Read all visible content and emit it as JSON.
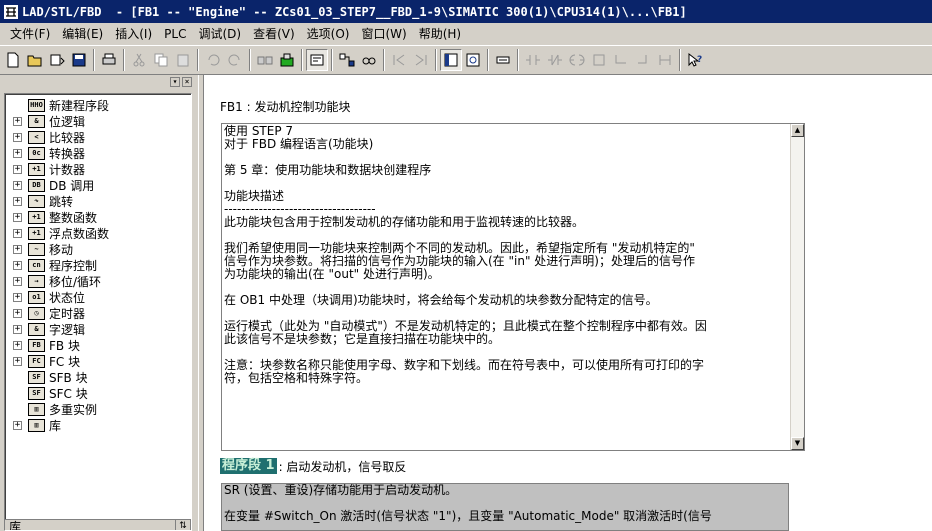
{
  "window": {
    "title": "LAD/STL/FBD  - [FB1 -- \"Engine\" -- ZCs01_03_STEP7__FBD_1-9\\SIMATIC 300(1)\\CPU314(1)\\...\\FB1]"
  },
  "menu": [
    "文件(F)",
    "编辑(E)",
    "插入(I)",
    "PLC",
    "调试(D)",
    "查看(V)",
    "选项(O)",
    "窗口(W)",
    "帮助(H)"
  ],
  "tree": {
    "items": [
      {
        "label": "新建程序段",
        "icon": "HHO",
        "expandable": false
      },
      {
        "label": "位逻辑",
        "icon": "&",
        "expandable": true
      },
      {
        "label": "比较器",
        "icon": "<",
        "expandable": true
      },
      {
        "label": "转换器",
        "icon": "0c",
        "expandable": true
      },
      {
        "label": "计数器",
        "icon": "+1",
        "expandable": true
      },
      {
        "label": "DB 调用",
        "icon": "DB",
        "expandable": true
      },
      {
        "label": "跳转",
        "icon": "↷",
        "expandable": true
      },
      {
        "label": "整数函数",
        "icon": "+1",
        "expandable": true
      },
      {
        "label": "浮点数函数",
        "icon": "+1",
        "expandable": true
      },
      {
        "label": "移动",
        "icon": "~",
        "expandable": true
      },
      {
        "label": "程序控制",
        "icon": "cn",
        "expandable": true
      },
      {
        "label": "移位/循环",
        "icon": "→",
        "expandable": true
      },
      {
        "label": "状态位",
        "icon": "o1",
        "expandable": true
      },
      {
        "label": "定时器",
        "icon": "◷",
        "expandable": true
      },
      {
        "label": "字逻辑",
        "icon": "&",
        "expandable": true
      },
      {
        "label": "FB 块",
        "icon": "FB",
        "expandable": true
      },
      {
        "label": "FC 块",
        "icon": "FC",
        "expandable": true
      },
      {
        "label": "SFB 块",
        "icon": "SF",
        "expandable": false
      },
      {
        "label": "SFC 块",
        "icon": "SF",
        "expandable": false
      },
      {
        "label": "多重实例",
        "icon": "▥",
        "expandable": false
      },
      {
        "label": "库",
        "icon": "▥",
        "expandable": true
      }
    ],
    "bottom_label": "库"
  },
  "editor": {
    "block_title": "FB1 : 发动机控制功能块",
    "comment_lines": [
      "使用 STEP 7",
      "对于 FBD 编程语言(功能块)",
      "",
      "第 5 章：使用功能块和数据块创建程序",
      "",
      "功能块描述",
      "-----------------------------------",
      "此功能块包含用于控制发动机的存储功能和用于监视转速的比较器。",
      "",
      "我们希望使用同一功能块来控制两个不同的发动机。因此，希望指定所有 \"发动机特定的\"",
      "信号作为块参数。将扫描的信号作为功能块的输入(在 \"in\" 处进行声明)；处理后的信号作",
      "为功能块的输出(在 \"out\" 处进行声明)。",
      "",
      "在 OB1 中处理（块调用)功能块时，将会给每个发动机的块参数分配特定的信号。",
      "",
      "运行模式（此处为 \"自动模式\"）不是发动机特定的；且此模式在整个控制程序中都有效。因",
      "此该信号不是块参数；它是直接扫描在功能块中的。",
      "",
      "注意：块参数名称只能使用字母、数字和下划线。而在符号表中，可以使用所有可打印的字",
      "符，包括空格和特殊字符。"
    ],
    "network_label": "程序段 1",
    "network_title": ": 启动发动机，信号取反",
    "network_comment_lines": [
      "SR (设置、重设)存储功能用于启动发动机。",
      "",
      "在变量 #Switch_On 激活时(信号状态 \"1\")，且变量 \"Automatic_Mode\" 取消激活时(信号"
    ]
  },
  "colors": {
    "titlebar": "#0a246a",
    "network_label_bg": "#1f6f6f",
    "network_label_fg": "#c8f0d8",
    "network_comment_bg": "#c0c0c0"
  }
}
